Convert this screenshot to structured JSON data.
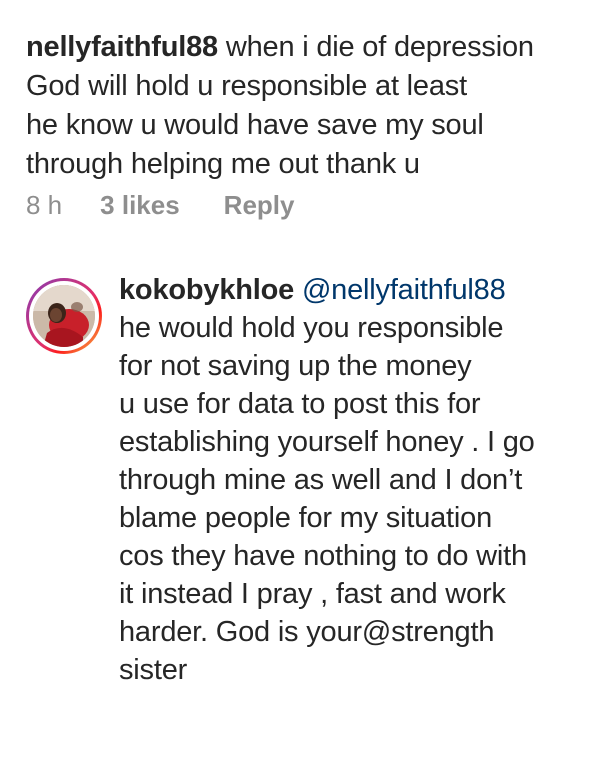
{
  "top_comment": {
    "username": "nellyfaithful88",
    "lines": [
      " when i die of depression",
      "God will hold u responsible at least",
      "he know u would have save my soul",
      "through helping me out thank u"
    ],
    "time": "8 h",
    "likes": "3 likes",
    "reply_label": "Reply"
  },
  "reply_comment": {
    "username": "kokobykhloe",
    "mention": "@nellyfaithful88",
    "lines": [
      "he would hold you responsible",
      "for not saving up the money",
      "u use for data to post this for",
      "establishing yourself honey . I go",
      "through mine as well and I don’t",
      "blame people for my situation",
      "cos they  have nothing to do with",
      "it instead I pray , fast and work",
      "harder. God is your@strength",
      "sister"
    ],
    "avatar_icon": "profile-photo"
  },
  "colors": {
    "text": "#262626",
    "meta": "#8e8e8e",
    "mention": "#00376b",
    "story_ring": [
      "#833ab4",
      "#c13584",
      "#e1306c",
      "#fd1d1d",
      "#f77737",
      "#fcaf45"
    ]
  }
}
